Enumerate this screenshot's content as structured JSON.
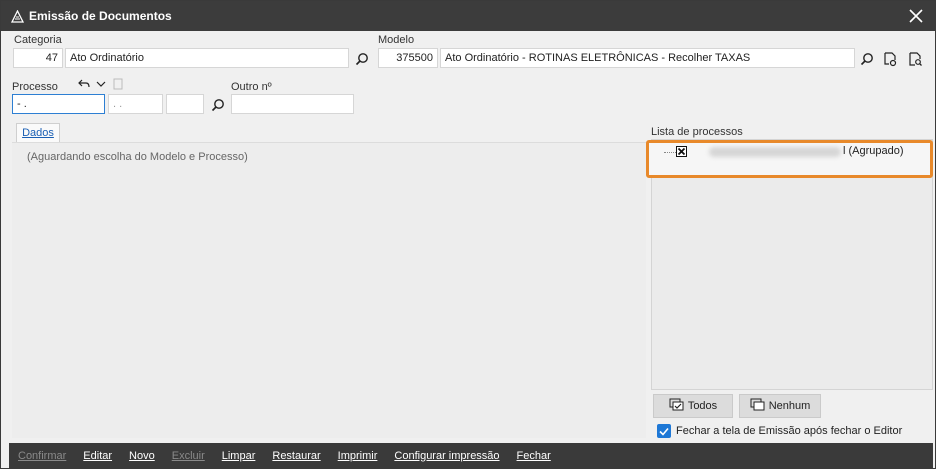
{
  "window": {
    "title": "Emissão de Documentos"
  },
  "form": {
    "categoria": {
      "label": "Categoria",
      "code": "47",
      "name": "Ato Ordinatório"
    },
    "modelo": {
      "label": "Modelo",
      "code": "375500",
      "name": "Ato Ordinatório - ROTINAS ELETRÔNICAS - Recolher TAXAS"
    },
    "processo": {
      "label": "Processo",
      "part1": " - .",
      "part2": ". .",
      "part3": ""
    },
    "outro": {
      "label": "Outro nº",
      "value": ""
    }
  },
  "tabs": [
    {
      "label": "Dados"
    }
  ],
  "dados": {
    "hint": "(Aguardando escolha do Modelo e Processo)"
  },
  "lista": {
    "label": "Lista de processos",
    "items": [
      {
        "text": "l (Agrupado)",
        "checked": true
      }
    ]
  },
  "buttons": {
    "todos": "Todos",
    "nenhum": "Nenhum"
  },
  "options": {
    "fechar_label": "Fechar a tela de Emissão após fechar o Editor",
    "fechar_checked": true
  },
  "actions": [
    {
      "label": "Confirmar",
      "enabled": false
    },
    {
      "label": "Editar",
      "enabled": true
    },
    {
      "label": "Novo",
      "enabled": true
    },
    {
      "label": "Excluir",
      "enabled": false
    },
    {
      "label": "Limpar",
      "enabled": true
    },
    {
      "label": "Restaurar",
      "enabled": true
    },
    {
      "label": "Imprimir",
      "enabled": true
    },
    {
      "label": "Configurar impressão",
      "enabled": true
    },
    {
      "label": "Fechar",
      "enabled": true
    }
  ],
  "colors": {
    "accent": "#1e78d6",
    "highlight": "#e8892a",
    "titlebar": "#3c3c3c"
  }
}
